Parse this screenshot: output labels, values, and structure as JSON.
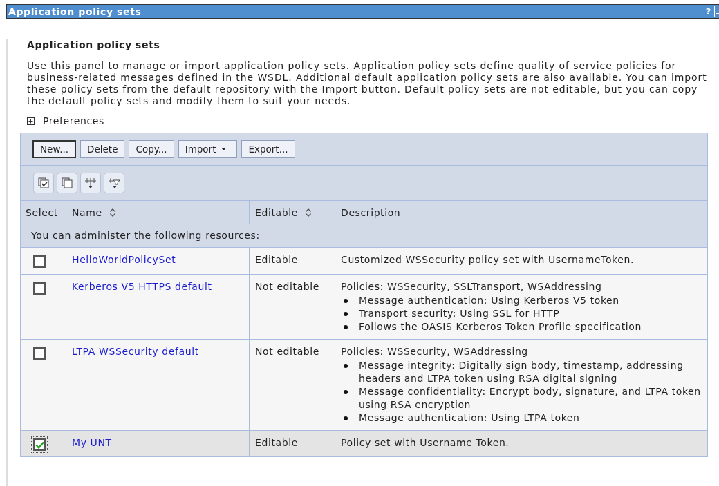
{
  "window": {
    "title": "Application policy sets",
    "help": "?"
  },
  "heading": "Application policy sets",
  "intro": "Use this panel to manage or import application policy sets. Application policy sets define quality of service policies for business-related messages defined in the WSDL. Additional default application policy sets are also available. You can import these policy sets from the default repository with the Import button. Default policy sets are not editable, but you can copy the default policy sets and modify them to suit your needs.",
  "preferences": {
    "label": "Preferences",
    "expanded": false
  },
  "buttons": [
    {
      "label": "New...",
      "focused": true,
      "menu": false
    },
    {
      "label": "Delete",
      "focused": false,
      "menu": false
    },
    {
      "label": "Copy...",
      "focused": false,
      "menu": false
    },
    {
      "label": "Import",
      "focused": false,
      "menu": true
    },
    {
      "label": "Export...",
      "focused": false,
      "menu": false
    }
  ],
  "table": {
    "columns": [
      {
        "label": "Select",
        "sortable": false
      },
      {
        "label": "Name",
        "sortable": true
      },
      {
        "label": "Editable",
        "sortable": true
      },
      {
        "label": "Description",
        "sortable": false
      }
    ],
    "group_label": "You can administer the following resources:",
    "rows": [
      {
        "selected": false,
        "name": "HelloWorldPolicySet",
        "editable": "Editable",
        "description": {
          "lead": "Customized WSSecurity policy set with UsernameToken."
        }
      },
      {
        "selected": false,
        "name": "Kerberos V5 HTTPS default",
        "editable": "Not editable",
        "description": {
          "lead": "Policies: WSSecurity, SSLTransport, WSAddressing",
          "bullets": [
            "Message authentication: Using Kerberos V5 token",
            "Transport security: Using SSL for HTTP",
            "Follows the OASIS Kerberos Token Profile specification"
          ]
        }
      },
      {
        "selected": false,
        "name": "LTPA WSSecurity default",
        "editable": "Not editable",
        "description": {
          "lead": "Policies: WSSecurity, WSAddressing",
          "bullets": [
            "Message integrity: Digitally sign body, timestamp, addressing headers and LTPA token using RSA digital signing",
            "Message confidentiality: Encrypt body, signature, and LTPA token using RSA encryption",
            "Message authentication: Using LTPA token"
          ]
        }
      },
      {
        "selected": true,
        "name": "My UNT",
        "editable": "Editable",
        "description": {
          "lead": "Policy set with Username Token."
        }
      }
    ]
  }
}
